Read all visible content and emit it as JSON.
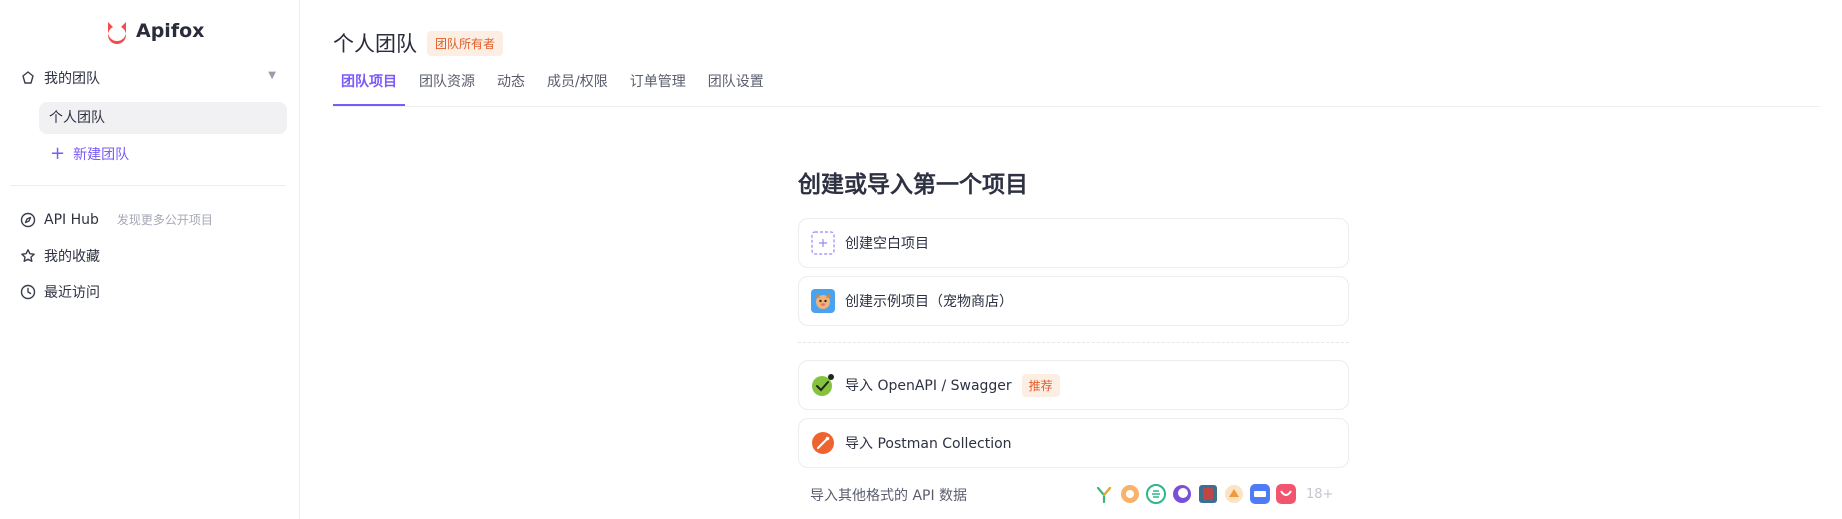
{
  "app": {
    "name": "Apifox",
    "brand_color": "#f24c4c",
    "accent": "#7a5af8"
  },
  "sidebar": {
    "team_group_label": "我的团队",
    "team_item": "个人团队",
    "new_team_label": "新建团队",
    "hub_label": "API Hub",
    "hub_hint": "发现更多公开项目",
    "favorites_label": "我的收藏",
    "recent_label": "最近访问"
  },
  "header": {
    "team_name": "个人团队",
    "owner_badge": "团队所有者",
    "tabs": [
      {
        "label": "团队项目",
        "active": true
      },
      {
        "label": "团队资源",
        "active": false
      },
      {
        "label": "动态",
        "active": false
      },
      {
        "label": "成员/权限",
        "active": false
      },
      {
        "label": "订单管理",
        "active": false
      },
      {
        "label": "团队设置",
        "active": false
      }
    ]
  },
  "main": {
    "heading": "创建或导入第一个项目",
    "create_blank": "创建空白项目",
    "create_sample": "创建示例项目（宠物商店）",
    "import_openapi": "导入 OpenAPI / Swagger",
    "recommended_badge": "推荐",
    "import_postman": "导入 Postman Collection",
    "import_other": "导入其他格式的 API 数据",
    "more_formats": "18+",
    "format_icons": [
      "yapi-icon",
      "rap-icon",
      "eolink-icon",
      "insomnia-icon",
      "jmeter-icon",
      "showdoc-icon",
      "har-icon",
      "apipost-icon"
    ]
  }
}
